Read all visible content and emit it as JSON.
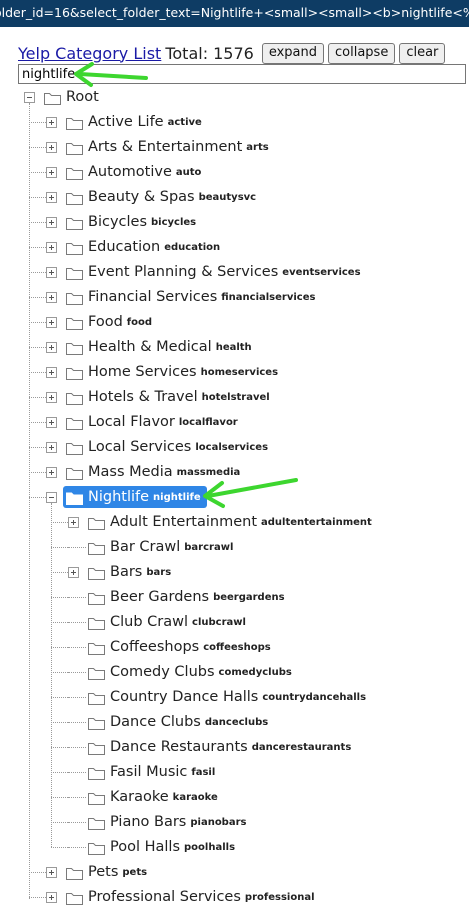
{
  "url_text": "older_id=16&select_folder_text=Nightlife+<small><small><b>nightlife<%2",
  "header": {
    "link": "Yelp Category List",
    "total_label": "Total:",
    "total_count": "1576",
    "buttons": {
      "expand": "expand",
      "collapse": "collapse",
      "clear": "clear"
    }
  },
  "search": {
    "value": "nightlife"
  },
  "tree": {
    "root": "Root",
    "categories": [
      {
        "label": "Active Life",
        "slug": "active"
      },
      {
        "label": "Arts & Entertainment",
        "slug": "arts"
      },
      {
        "label": "Automotive",
        "slug": "auto"
      },
      {
        "label": "Beauty & Spas",
        "slug": "beautysvc"
      },
      {
        "label": "Bicycles",
        "slug": "bicycles"
      },
      {
        "label": "Education",
        "slug": "education"
      },
      {
        "label": "Event Planning & Services",
        "slug": "eventservices"
      },
      {
        "label": "Financial Services",
        "slug": "financialservices"
      },
      {
        "label": "Food",
        "slug": "food"
      },
      {
        "label": "Health & Medical",
        "slug": "health"
      },
      {
        "label": "Home Services",
        "slug": "homeservices"
      },
      {
        "label": "Hotels & Travel",
        "slug": "hotelstravel"
      },
      {
        "label": "Local Flavor",
        "slug": "localflavor"
      },
      {
        "label": "Local Services",
        "slug": "localservices"
      },
      {
        "label": "Mass Media",
        "slug": "massmedia"
      }
    ],
    "selected": {
      "label": "Nightlife",
      "slug": "nightlife"
    },
    "children": [
      {
        "label": "Adult Entertainment",
        "slug": "adultentertainment",
        "expandable": true
      },
      {
        "label": "Bar Crawl",
        "slug": "barcrawl",
        "expandable": false
      },
      {
        "label": "Bars",
        "slug": "bars",
        "expandable": true
      },
      {
        "label": "Beer Gardens",
        "slug": "beergardens",
        "expandable": false
      },
      {
        "label": "Club Crawl",
        "slug": "clubcrawl",
        "expandable": false
      },
      {
        "label": "Coffeeshops",
        "slug": "coffeeshops",
        "expandable": false
      },
      {
        "label": "Comedy Clubs",
        "slug": "comedyclubs",
        "expandable": false
      },
      {
        "label": "Country Dance Halls",
        "slug": "countrydancehalls",
        "expandable": false
      },
      {
        "label": "Dance Clubs",
        "slug": "danceclubs",
        "expandable": false
      },
      {
        "label": "Dance Restaurants",
        "slug": "dancerestaurants",
        "expandable": false
      },
      {
        "label": "Fasil Music",
        "slug": "fasil",
        "expandable": false
      },
      {
        "label": "Karaoke",
        "slug": "karaoke",
        "expandable": false
      },
      {
        "label": "Piano Bars",
        "slug": "pianobars",
        "expandable": false
      },
      {
        "label": "Pool Halls",
        "slug": "poolhalls",
        "expandable": false
      }
    ],
    "after": [
      {
        "label": "Pets",
        "slug": "pets"
      },
      {
        "label": "Professional Services",
        "slug": "professional"
      }
    ]
  },
  "colors": {
    "url_bar": "#0e3c64",
    "selected": "#2f86e6",
    "annotation_arrow": "#3dd62f"
  },
  "icons": {
    "folder": "folder-icon",
    "expand": "plus-toggle-icon",
    "collapse": "minus-toggle-icon",
    "arrow": "green-arrow-annotation"
  }
}
